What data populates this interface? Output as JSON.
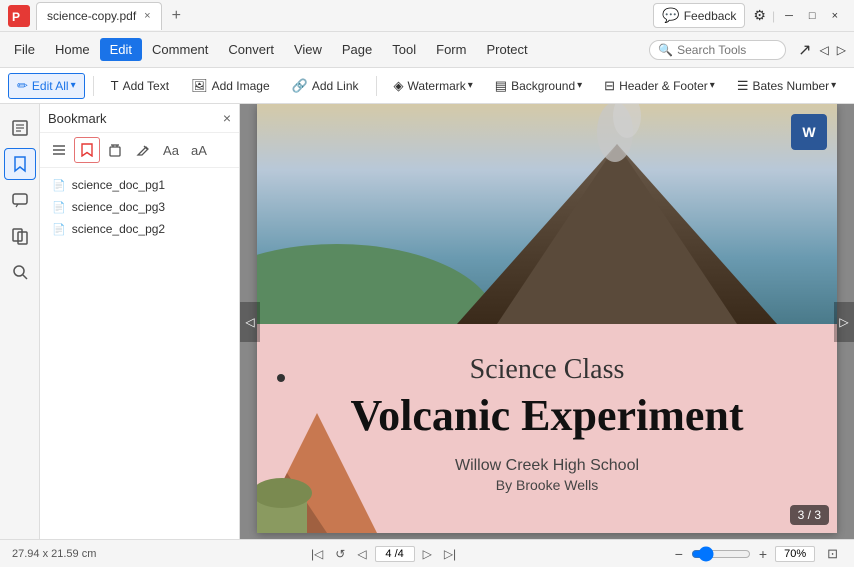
{
  "titleBar": {
    "tab": {
      "label": "science-copy.pdf",
      "closeLabel": "×"
    },
    "addTab": "+",
    "feedback": {
      "label": "Feedback"
    },
    "winBtns": {
      "minimize": "─",
      "maximize": "□",
      "close": "×"
    }
  },
  "menuBar": {
    "items": [
      {
        "id": "file",
        "label": "File"
      },
      {
        "id": "home",
        "label": "Home"
      },
      {
        "id": "edit",
        "label": "Edit",
        "active": true
      },
      {
        "id": "comment",
        "label": "Comment"
      },
      {
        "id": "convert",
        "label": "Convert"
      },
      {
        "id": "view",
        "label": "View"
      },
      {
        "id": "page",
        "label": "Page"
      },
      {
        "id": "tool",
        "label": "Tool"
      },
      {
        "id": "form",
        "label": "Form"
      },
      {
        "id": "protect",
        "label": "Protect"
      }
    ],
    "search": {
      "placeholder": "Search Tools"
    }
  },
  "toolbar": {
    "editAll": "Edit All",
    "addText": "Add Text",
    "addImage": "Add Image",
    "addLink": "Add Link",
    "watermark": "Watermark",
    "background": "Background",
    "headerFooter": "Header & Footer",
    "batesNumber": "Bates Number"
  },
  "bookmark": {
    "title": "Bookmark",
    "items": [
      {
        "label": "science_doc_pg1"
      },
      {
        "label": "science_doc_pg3"
      },
      {
        "label": "science_doc_pg2"
      }
    ]
  },
  "pdfPage": {
    "subtitle": "Science Class",
    "title": "Volcanic Experiment",
    "school": "Willow Creek High School",
    "author": "By Brooke Wells",
    "badge": "3 / 3"
  },
  "statusBar": {
    "dimensions": "27.94 x 21.59 cm",
    "page": "4 / 4",
    "zoom": "70%"
  },
  "wordIcon": "W"
}
